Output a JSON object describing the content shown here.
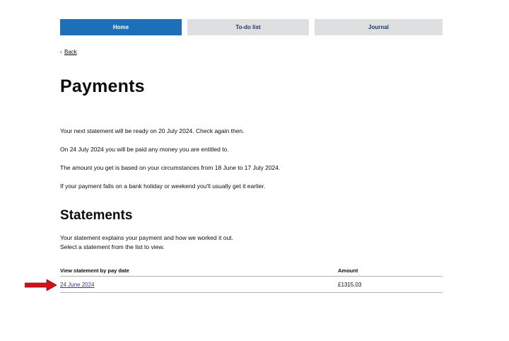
{
  "nav": {
    "tabs": [
      {
        "label": "Home",
        "active": true
      },
      {
        "label": "To-do list",
        "active": false
      },
      {
        "label": "Journal",
        "active": false
      }
    ]
  },
  "back": {
    "label": "Back",
    "icon": "chevron-left-icon"
  },
  "page_title": "Payments",
  "paragraphs": [
    "Your next statement will be ready on 20 July 2024. Check again then.",
    "On 24 July 2024 you will be paid any money you are entitled to.",
    "The amount you get is based on your circumstances from 18 June to 17 July 2024.",
    "If your payment falls on a bank holiday or weekend you'll usually get it earlier."
  ],
  "statements": {
    "heading": "Statements",
    "intro_line1": "Your statement explains your payment and how we worked it out.",
    "intro_line2": "Select a statement from the list to view.",
    "table": {
      "headers": [
        "View statement by pay date",
        "Amount"
      ],
      "rows": [
        {
          "date": "24 June 2024",
          "amount": "£1315.03"
        }
      ]
    }
  },
  "annotation": {
    "icon": "red-arrow-icon",
    "color": "#d4111b"
  },
  "colors": {
    "primary": "#1d70b8",
    "tab_inactive": "#dedfe0",
    "link_visited": "#4c2c92"
  }
}
